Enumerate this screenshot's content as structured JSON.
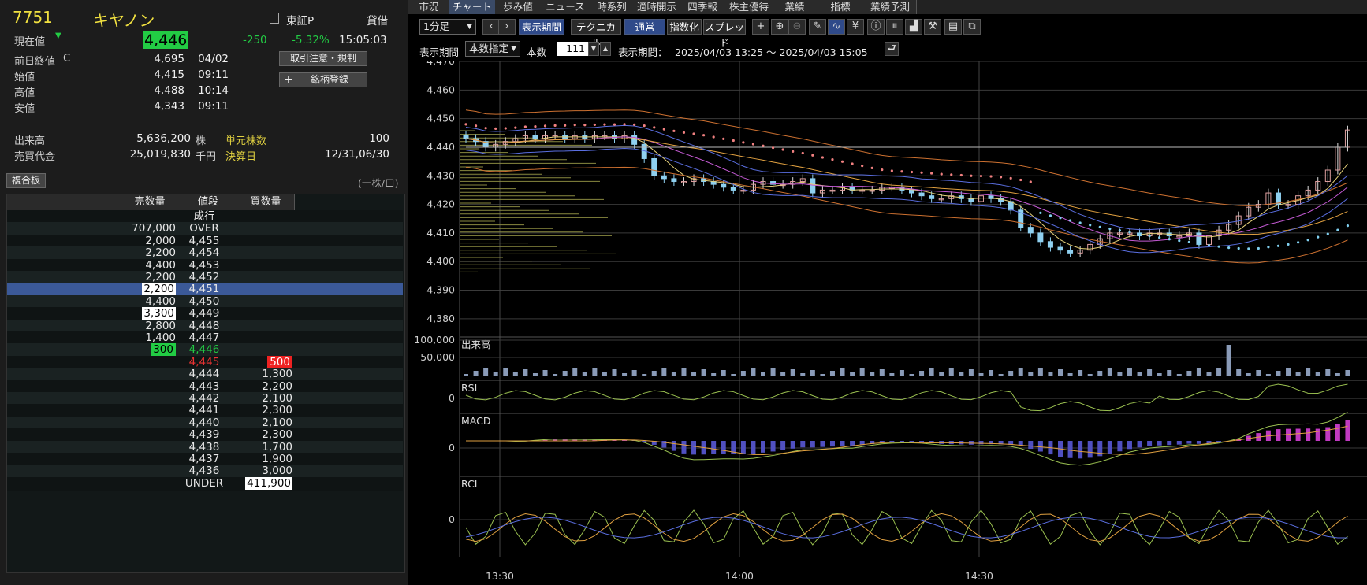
{
  "stock": {
    "code": "7751",
    "name": "キヤノン",
    "market": "東証P",
    "lending": "貸借",
    "current_label": "現在値",
    "current_price": "4,446",
    "change": "-250",
    "change_pct": "-5.32%",
    "time": "15:05:03"
  },
  "quote_rows": [
    {
      "label": "前日終値",
      "flag": "C",
      "value": "4,695",
      "time": "04/02"
    },
    {
      "label": "始値",
      "flag": "",
      "value": "4,415",
      "time": "09:11"
    },
    {
      "label": "高値",
      "flag": "",
      "value": "4,488",
      "time": "10:14"
    },
    {
      "label": "安値",
      "flag": "",
      "value": "4,343",
      "time": "09:11"
    }
  ],
  "buttons": {
    "trade_notice": "取引注意・規制",
    "add_watch": "銘柄登録",
    "add_icon": "+"
  },
  "volume": {
    "label": "出来高",
    "value": "5,636,200",
    "unit": "株",
    "unit_shares_label": "単元株数",
    "unit_shares": "100"
  },
  "turnover": {
    "label": "売買代金",
    "value": "25,019,830",
    "unit": "千円",
    "settle_label": "決算日",
    "settle": "12/31,06/30"
  },
  "board": {
    "title": "複合板",
    "per_unit": "(一株/口)",
    "headers": {
      "sell": "売数量",
      "price": "値段",
      "buy": "買数量"
    },
    "rows": [
      {
        "sell": "",
        "price": "成行",
        "buy": ""
      },
      {
        "sell": "707,000",
        "price": "OVER",
        "buy": ""
      },
      {
        "sell": "2,000",
        "price": "4,455",
        "buy": ""
      },
      {
        "sell": "2,200",
        "price": "4,454",
        "buy": ""
      },
      {
        "sell": "4,400",
        "price": "4,453",
        "buy": ""
      },
      {
        "sell": "2,200",
        "price": "4,452",
        "buy": ""
      },
      {
        "sell": "2,200",
        "price": "4,451",
        "buy": ""
      },
      {
        "sell": "4,400",
        "price": "4,450",
        "buy": ""
      },
      {
        "sell": "3,300",
        "price": "4,449",
        "buy": ""
      },
      {
        "sell": "2,800",
        "price": "4,448",
        "buy": ""
      },
      {
        "sell": "1,400",
        "price": "4,447",
        "buy": ""
      },
      {
        "sell": "300",
        "price": "4,446",
        "buy": ""
      },
      {
        "sell": "",
        "price": "4,445",
        "buy": "500"
      },
      {
        "sell": "",
        "price": "4,444",
        "buy": "1,300"
      },
      {
        "sell": "",
        "price": "4,443",
        "buy": "2,200"
      },
      {
        "sell": "",
        "price": "4,442",
        "buy": "2,100"
      },
      {
        "sell": "",
        "price": "4,441",
        "buy": "2,300"
      },
      {
        "sell": "",
        "price": "4,440",
        "buy": "2,100"
      },
      {
        "sell": "",
        "price": "4,439",
        "buy": "2,300"
      },
      {
        "sell": "",
        "price": "4,438",
        "buy": "1,700"
      },
      {
        "sell": "",
        "price": "4,437",
        "buy": "1,900"
      },
      {
        "sell": "",
        "price": "4,436",
        "buy": "3,000"
      },
      {
        "sell": "",
        "price": "UNDER",
        "buy": "411,900"
      }
    ]
  },
  "tabs": [
    "市況",
    "チャート",
    "歩み値",
    "ニュース",
    "時系列",
    "適時開示",
    "四季報",
    "株主優待",
    "業績",
    "指標",
    "業績予測"
  ],
  "toolbar": {
    "interval": "1分足",
    "period_btn": "表示期間",
    "tech_btn": "テクニカル",
    "normal_btn": "通常",
    "index_btn": "指数化",
    "spread_btn": "スプレッド",
    "prev": "‹",
    "next": "›"
  },
  "period": {
    "label": "表示期間",
    "mode": "本数指定",
    "count_label": "本数",
    "count": "111",
    "range_label": "表示期間：",
    "range": "2025/04/03 13:25 ～ 2025/04/03 15:05"
  },
  "chart_data": {
    "type": "candlestick",
    "ylim": [
      4375,
      4470
    ],
    "yticks": [
      "4,470",
      "4,460",
      "4,450",
      "4,440",
      "4,430",
      "4,420",
      "4,410",
      "4,400",
      "4,390",
      "4,380"
    ],
    "xticks": [
      "13:30",
      "14:00",
      "14:30"
    ],
    "close": [
      4443,
      4442,
      4440,
      4441,
      4442,
      4443,
      4444,
      4443,
      4444,
      4444,
      4443,
      4444,
      4443,
      4444,
      4444,
      4443,
      4444,
      4441,
      4436,
      4430,
      4429,
      4428,
      4428,
      4429,
      4428,
      4427,
      4426,
      4425,
      4425,
      4427,
      4428,
      4427,
      4427,
      4428,
      4429,
      4424,
      4425,
      4425,
      4426,
      4425,
      4425,
      4425,
      4426,
      4426,
      4425,
      4424,
      4423,
      4422,
      4422,
      4423,
      4422,
      4421,
      4423,
      4422,
      4421,
      4418,
      4412,
      4410,
      4407,
      4405,
      4404,
      4403,
      4404,
      4406,
      4408,
      4410,
      4410,
      4410,
      4409,
      4410,
      4410,
      4409,
      4409,
      4410,
      4406,
      4409,
      4411,
      4413,
      4416,
      4419,
      4420,
      4424,
      4420,
      4420,
      4423,
      4425,
      4428,
      4432,
      4440,
      4446
    ],
    "panels": {
      "volume": {
        "label": "出来高",
        "ticks": [
          "100,000",
          "50,000"
        ]
      },
      "rsi": {
        "label": "RSI",
        "ticks": [
          "0"
        ]
      },
      "macd": {
        "label": "MACD",
        "ticks": [
          "0"
        ]
      },
      "rci": {
        "label": "RCI",
        "ticks": [
          "0"
        ]
      }
    }
  }
}
